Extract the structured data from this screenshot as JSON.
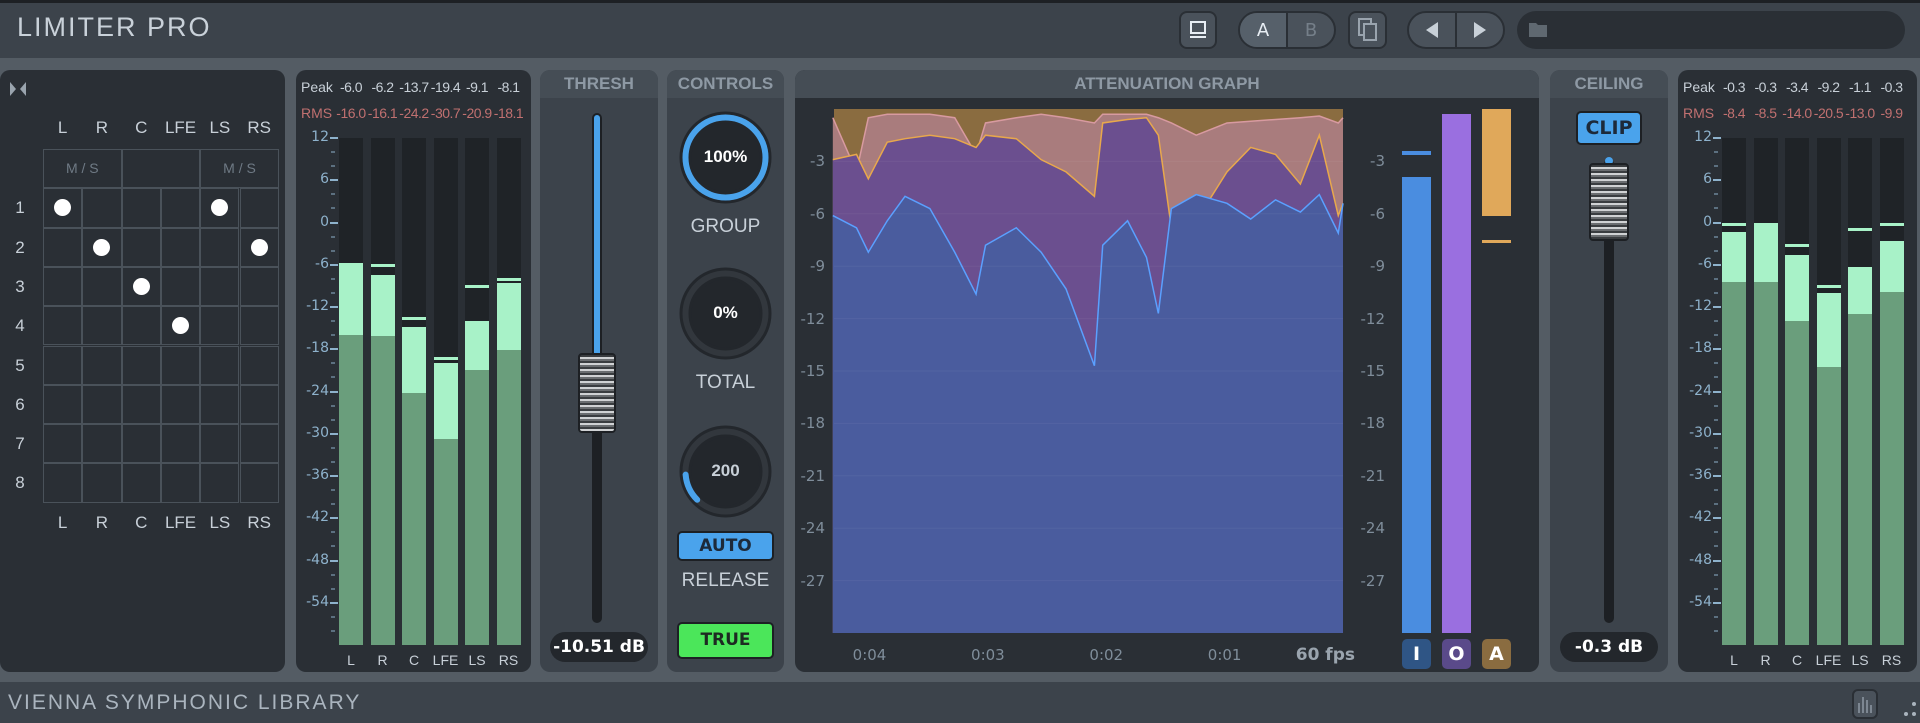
{
  "header": {
    "title": "LIMITER PRO",
    "ab": {
      "a": "A",
      "b": "B"
    },
    "preset_name": ""
  },
  "footer": {
    "brand": "VIENNA SYMPHONIC LIBRARY"
  },
  "routing": {
    "channels": [
      "L",
      "R",
      "C",
      "LFE",
      "LS",
      "RS"
    ],
    "rows": [
      "1",
      "2",
      "3",
      "4",
      "5",
      "6",
      "7",
      "8"
    ],
    "ms_label": "M / S",
    "assignments": [
      [
        0,
        0
      ],
      [
        0,
        4
      ],
      [
        1,
        1
      ],
      [
        1,
        5
      ],
      [
        2,
        2
      ],
      [
        3,
        3
      ]
    ]
  },
  "input_meter": {
    "peak_label": "Peak",
    "rms_label": "RMS",
    "channels": [
      "L",
      "R",
      "C",
      "LFE",
      "LS",
      "RS"
    ],
    "peak_text": [
      "-6.0",
      "-6.2",
      "-13.7",
      "-19.4",
      "-9.1",
      "-8.1"
    ],
    "rms_text": [
      "-16.0",
      "-16.1",
      "-24.2",
      "-30.7",
      "-20.9",
      "-18.1"
    ],
    "peak": [
      -6.0,
      -6.2,
      -13.7,
      -19.4,
      -9.1,
      -8.1
    ],
    "level": [
      -6.1,
      -7.5,
      -14.8,
      -20.0,
      -14.0,
      -8.6
    ],
    "rms": [
      -16.0,
      -16.1,
      -24.2,
      -30.7,
      -20.9,
      -18.1
    ],
    "scale": [
      "12",
      "6",
      "0",
      "-6",
      "-12",
      "-18",
      "-24",
      "-30",
      "-36",
      "-42",
      "-48",
      "-54"
    ]
  },
  "output_meter": {
    "peak_label": "Peak",
    "rms_label": "RMS",
    "channels": [
      "L",
      "R",
      "C",
      "LFE",
      "LS",
      "RS"
    ],
    "peak_text": [
      "-0.3",
      "-0.3",
      "-3.4",
      "-9.2",
      "-1.1",
      "-0.3"
    ],
    "rms_text": [
      "-8.4",
      "-8.5",
      "-14.0",
      "-20.5",
      "-13.0",
      "-9.9"
    ],
    "peak": [
      -0.3,
      -0.3,
      -3.4,
      -9.2,
      -1.1,
      -0.3
    ],
    "level": [
      -1.4,
      -0.5,
      -4.6,
      -10.0,
      -6.3,
      -2.6
    ],
    "rms": [
      -8.4,
      -8.5,
      -14.0,
      -20.5,
      -13.0,
      -9.9
    ],
    "scale": [
      "12",
      "6",
      "0",
      "-6",
      "-12",
      "-18",
      "-24",
      "-30",
      "-36",
      "-42",
      "-48",
      "-54"
    ]
  },
  "thresh": {
    "title": "THRESH",
    "value_text": "-10.51 dB",
    "value_db": -10.51
  },
  "controls": {
    "title": "CONTROLS",
    "group": {
      "value": "100%",
      "label": "GROUP",
      "fraction": 1.0
    },
    "total": {
      "value": "0%",
      "label": "TOTAL",
      "fraction": 0.0
    },
    "release": {
      "value": "200",
      "label": "RELEASE",
      "fraction": 0.15
    },
    "auto_label": "AUTO",
    "true_label": "TRUE"
  },
  "graph": {
    "title": "ATTENUATION GRAPH",
    "y_labels": [
      "-3",
      "-6",
      "-9",
      "-12",
      "-15",
      "-18",
      "-21",
      "-24",
      "-27"
    ],
    "time_labels": [
      "0:04",
      "0:03",
      "0:02",
      "0:01"
    ],
    "fps": "60 fps",
    "buttons": {
      "i": "I",
      "o": "O",
      "a": "A"
    },
    "input_level_db": -3.9,
    "input_hold_db": -2.4,
    "output_level_db": -0.3,
    "atten_db": -6.1,
    "atten_hold_db": -7.5
  },
  "chart_data": {
    "type": "area",
    "ylim": [
      -30,
      0
    ],
    "xlim": [
      -4.3,
      0
    ],
    "t": [
      -4.31,
      -4.11,
      -4.01,
      -3.85,
      -3.7,
      -3.49,
      -3.28,
      -3.1,
      -3.02,
      -2.76,
      -2.55,
      -2.34,
      -2.1,
      -2.03,
      -1.82,
      -1.66,
      -1.56,
      -1.45,
      -1.24,
      -0.98,
      -0.78,
      -0.57,
      -0.36,
      -0.2,
      -0.04,
      0
    ],
    "series": [
      {
        "name": "envelope",
        "color": "#a97c7d",
        "values": [
          -0.5,
          -3.6,
          -0.5,
          -0.3,
          -0.3,
          -0.3,
          -0.5,
          -2.6,
          -0.8,
          -0.5,
          -0.3,
          -0.5,
          -0.8,
          -0.3,
          -0.3,
          -0.3,
          -0.5,
          -0.8,
          -1.5,
          -0.8,
          -0.7,
          -0.6,
          -0.5,
          -0.4,
          -0.8,
          -0.5
        ]
      },
      {
        "name": "output",
        "color": "#6b4f8f",
        "values": [
          -2.9,
          -2.6,
          -4.0,
          -1.9,
          -1.7,
          -1.5,
          -1.7,
          -2.2,
          -1.5,
          -1.7,
          -2.9,
          -3.6,
          -5.0,
          -0.8,
          -0.6,
          -0.5,
          -1.5,
          -6.8,
          -6.4,
          -3.6,
          -2.2,
          -2.6,
          -4.3,
          -1.5,
          -6.1,
          -5.4
        ]
      },
      {
        "name": "input",
        "color": "#4a5c9e",
        "values": [
          -6.1,
          -6.8,
          -8.2,
          -6.4,
          -5.0,
          -5.7,
          -8.2,
          -10.6,
          -7.8,
          -6.8,
          -8.2,
          -10.3,
          -14.7,
          -7.8,
          -6.4,
          -8.5,
          -11.7,
          -5.7,
          -4.9,
          -5.4,
          -6.3,
          -5.2,
          -5.9,
          -4.9,
          -7.1,
          -5.4
        ]
      }
    ]
  },
  "ceiling": {
    "title": "CEILING",
    "clip_label": "CLIP",
    "value_text": "-0.3 dB",
    "value_db": -0.3
  },
  "colors": {
    "accent": "#4aa3ec",
    "true_green": "#4be65a",
    "meter_rms": "#6a9e7c",
    "meter_peak": "#a8f2c8"
  }
}
